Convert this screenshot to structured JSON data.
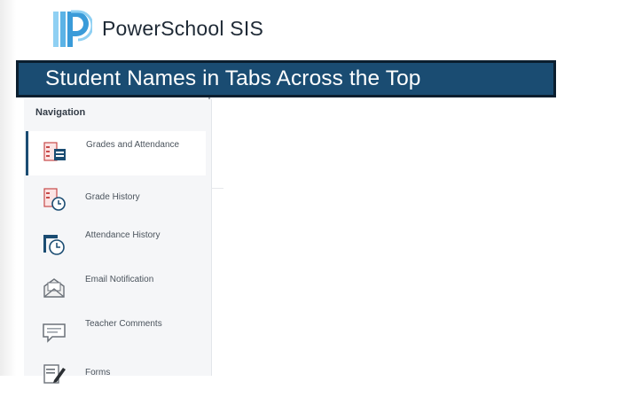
{
  "app": {
    "title": "PowerSchool SIS"
  },
  "banner": {
    "text": "Student Names in Tabs Across the Top"
  },
  "navigation": {
    "heading": "Navigation",
    "items": [
      {
        "label": "Grades and Attendance",
        "icon": "grades-attendance-icon",
        "active": true
      },
      {
        "label": "Grade History",
        "icon": "grade-history-icon",
        "active": false
      },
      {
        "label": "Attendance History",
        "icon": "attendance-history-icon",
        "active": false
      },
      {
        "label": "Email Notification",
        "icon": "email-notification-icon",
        "active": false
      },
      {
        "label": "Teacher Comments",
        "icon": "teacher-comments-icon",
        "active": false
      },
      {
        "label": "Forms",
        "icon": "forms-icon",
        "active": false
      }
    ]
  },
  "colors": {
    "brand": "#1a4c72",
    "logo": "#5bb3e6"
  }
}
